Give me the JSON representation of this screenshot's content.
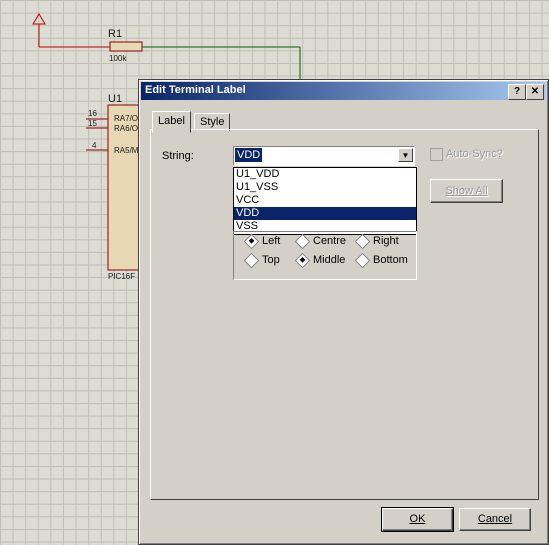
{
  "schematic": {
    "r1_ref": "R1",
    "r1_value": "100k",
    "u1_ref": "U1",
    "pin_nums": [
      "16",
      "15",
      "4"
    ],
    "pin_names": [
      "RA7/O",
      "RA6/O",
      "RA5/M"
    ],
    "chip_part": "PIC16F"
  },
  "dialog": {
    "title": "Edit Terminal Label",
    "help_btn": "?",
    "close_btn": "✕",
    "tabs": [
      "Label",
      "Style"
    ],
    "string_label": "String:",
    "string_value": "VDD",
    "options": [
      "U1_VDD",
      "U1_VSS",
      "VCC",
      "VDD",
      "VSS"
    ],
    "selected_option": "VDD",
    "auto_sync": "Auto-Sync?",
    "show_all": "Show All",
    "radios": {
      "left": "Left",
      "centre": "Centre",
      "right": "Right",
      "top": "Top",
      "middle": "Middle",
      "bottom": "Bottom"
    },
    "ok": "OK",
    "cancel": "Cancel"
  }
}
